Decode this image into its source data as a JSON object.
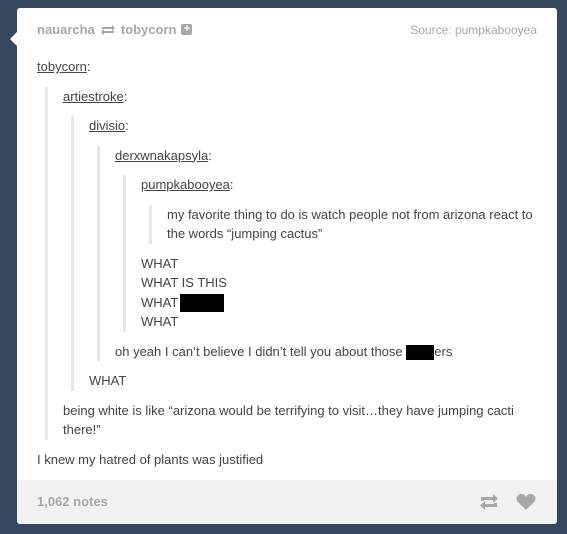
{
  "post": {
    "reblogger": "nauarcha",
    "reblogged_from": "tobycorn",
    "source_prefix": "Source:",
    "source_name": "pumpkabooyea"
  },
  "thread": {
    "user1": "tobycorn",
    "user2": "artiestroke",
    "user3": "divisio",
    "user4": "derxwnakapsyla",
    "user5": "pumpkabooyea",
    "colon": ":",
    "quote_text": "my favorite thing to do is watch people not from arizona react to the words “jumping cactus”",
    "what_1": "WHAT",
    "what_2": "WHAT IS THIS",
    "what_3": "WHAT",
    "what_4": "WHAT",
    "derx_reply_pre": "oh yeah I can’t believe I didn’t tell you about those",
    "derx_reply_post": "ers",
    "divisio_reply": "WHAT",
    "artie_reply": "being white is like “arizona would be terrifying to visit…they have jumping cacti there!”",
    "toby_reply": "I knew my hatred of plants was justified"
  },
  "footer": {
    "notes": "1,062 notes",
    "reblog_icon": "reblog-icon",
    "like_icon": "heart-icon"
  },
  "colors": {
    "background": "#36465d",
    "card": "#ffffff",
    "muted": "#a7a7a7",
    "text": "#444444",
    "rule": "#e7e7e7",
    "footer": "#f2f2f2"
  }
}
